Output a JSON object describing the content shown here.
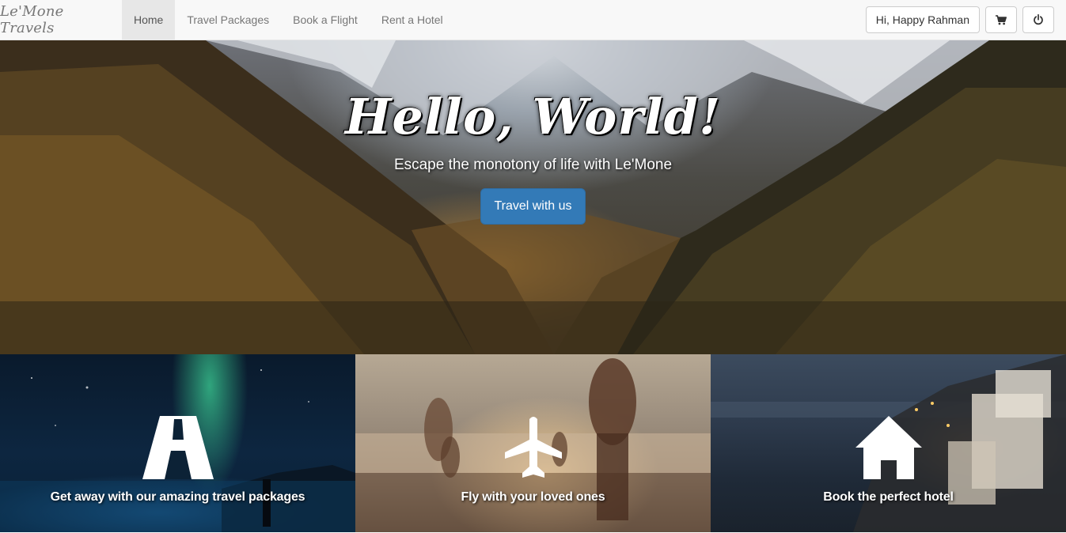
{
  "navbar": {
    "brand": "Le'Mone Travels",
    "links": [
      {
        "label": "Home",
        "active": true
      },
      {
        "label": "Travel Packages",
        "active": false
      },
      {
        "label": "Book a Flight",
        "active": false
      },
      {
        "label": "Rent a Hotel",
        "active": false
      }
    ],
    "user_greeting": "Hi, Happy Rahman",
    "cart_icon": "shopping-cart-icon",
    "logout_icon": "power-icon"
  },
  "hero": {
    "title": "Hello, World!",
    "subtitle": "Escape the monotony of life with Le'Mone",
    "cta_label": "Travel with us"
  },
  "tiles": [
    {
      "label": "Get away with our amazing travel packages",
      "icon": "road-icon"
    },
    {
      "label": "Fly with your loved ones",
      "icon": "airplane-icon"
    },
    {
      "label": "Book the perfect hotel",
      "icon": "house-icon"
    }
  ],
  "colors": {
    "primary": "#337ab7",
    "navbar_bg": "#f8f8f8",
    "nav_active_bg": "#e7e7e7",
    "nav_text": "#777777"
  }
}
